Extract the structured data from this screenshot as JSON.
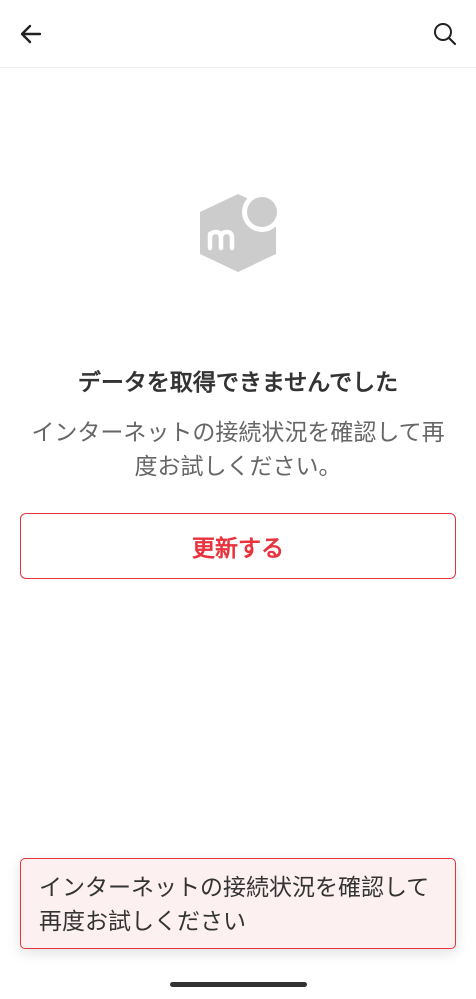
{
  "app_bar": {
    "back_icon": "arrow-left-icon",
    "search_icon": "search-icon"
  },
  "logo_icon": "mercari-cube-logo-icon",
  "error": {
    "title": "データを取得できませんでした",
    "message": "インターネットの接続状況を確認して再度お試しください。"
  },
  "refresh_button": {
    "label": "更新する"
  },
  "toast": {
    "message": "インターネットの接続状況を確認して再度お試しください"
  },
  "colors": {
    "accent": "#e8323c",
    "toast_bg": "#fdf0f1",
    "logo_gray": "#cccccc"
  }
}
